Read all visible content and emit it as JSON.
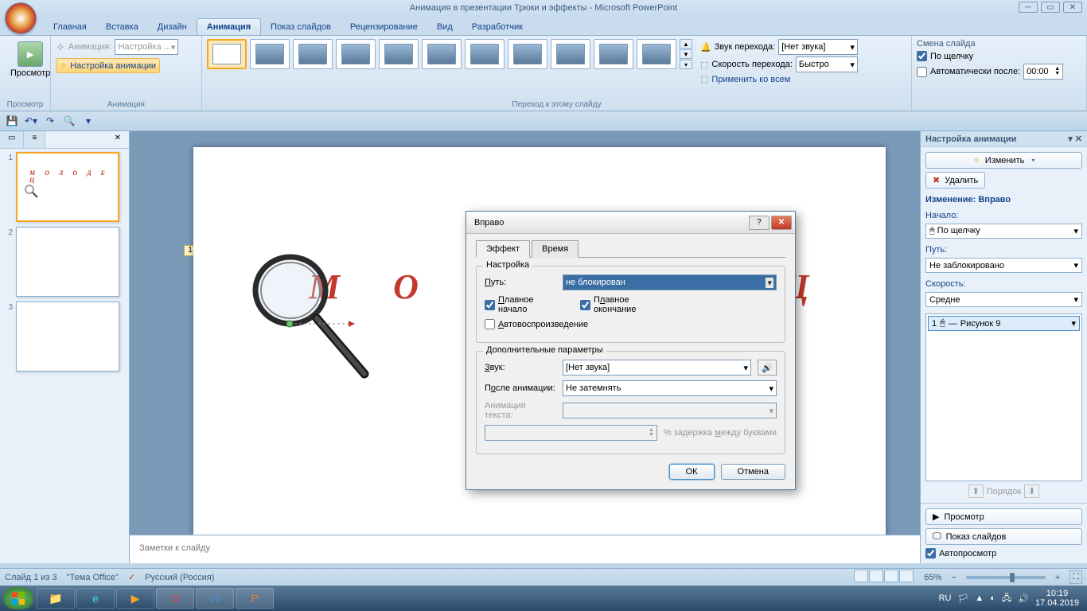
{
  "window": {
    "title": "Анимация в презентации Трюки и эффекты - Microsoft PowerPoint"
  },
  "tabs": {
    "home": "Главная",
    "insert": "Вставка",
    "design": "Дизайн",
    "animation": "Анимация",
    "slideshow": "Показ слайдов",
    "review": "Рецензирование",
    "view": "Вид",
    "developer": "Разработчик"
  },
  "ribbon": {
    "preview_group": "Просмотр",
    "preview_btn": "Просмотр",
    "animation_group": "Анимация",
    "animation_label": "Анимация:",
    "animation_value": "Настройка ...",
    "custom_anim_btn": "Настройка анимации",
    "transition_group": "Переход к этому слайду",
    "sound_label": "Звук перехода:",
    "sound_value": "[Нет звука]",
    "speed_label": "Скорость перехода:",
    "speed_value": "Быстро",
    "apply_all": "Применить ко всем",
    "advance_group": "Смена слайда",
    "on_click": "По щелчку",
    "auto_after": "Автоматически после:",
    "auto_after_value": "00:00"
  },
  "slide": {
    "text": "М  О  Л  О  Д  Е  Ц",
    "marker": "1",
    "notes_placeholder": "Заметки к слайду"
  },
  "dialog": {
    "title": "Вправо",
    "tab_effect": "Эффект",
    "tab_timing": "Время",
    "group_settings": "Настройка",
    "path_label": "Путь:",
    "path_value": "не блокирован",
    "smooth_start": "Плавное начало",
    "smooth_end": "Плавное окончание",
    "autoplay": "Автовоспроизведение",
    "group_extra": "Дополнительные параметры",
    "sound_label": "Звук:",
    "sound_value": "[Нет звука]",
    "after_label": "После анимации:",
    "after_value": "Не затемнять",
    "text_anim_label": "Анимация текста:",
    "delay_label": "% задержка между буквами",
    "ok": "ОК",
    "cancel": "Отмена"
  },
  "taskpane": {
    "title": "Настройка анимации",
    "change_btn": "Изменить",
    "remove_btn": "Удалить",
    "change_label": "Изменение: Вправо",
    "start_label": "Начало:",
    "start_value": "По щелчку",
    "path_label": "Путь:",
    "path_value": "Не заблокировано",
    "speed_label": "Скорость:",
    "speed_value": "Средне",
    "item_num": "1",
    "item_name": "Рисунок 9",
    "order_label": "Порядок",
    "preview_btn": "Просмотр",
    "slideshow_btn": "Показ слайдов",
    "autopreview": "Автопросмотр"
  },
  "statusbar": {
    "slide_info": "Слайд 1 из 3",
    "theme": "\"Тема Office\"",
    "language": "Русский (Россия)",
    "zoom": "65%"
  },
  "taskbar": {
    "lang": "RU",
    "time": "10:19",
    "date": "17.04.2019"
  }
}
